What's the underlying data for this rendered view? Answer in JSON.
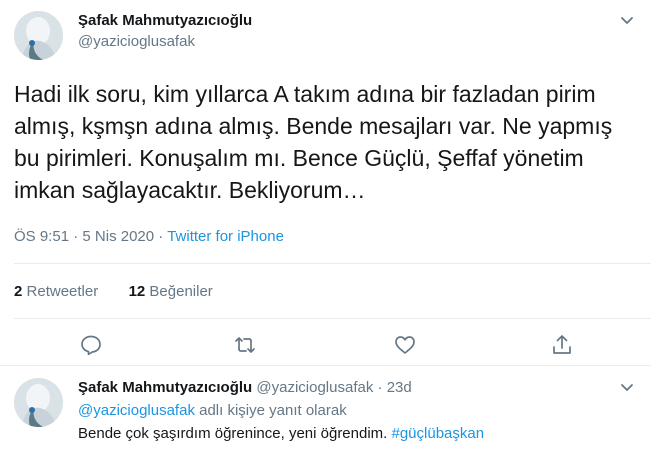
{
  "main_tweet": {
    "author": {
      "display_name": "Şafak Mahmutyazıcıoğlu",
      "handle": "@yazicioglusafak"
    },
    "text": "Hadi ilk soru, kim yıllarca A takım adına bir fazladan pirim almış, kşmşn adına almış. Bende mesajları var. Ne yapmış bu pirimleri. Konuşalım mı. Bence Güçlü, Şeffaf yönetim imkan sağlayacaktır. Bekliyorum…",
    "time": "ÖS 9:51",
    "separator": "·",
    "date": "5 Nis 2020",
    "source": "Twitter for iPhone",
    "stats": {
      "retweets_count": "2",
      "retweets_label": "Retweetler",
      "likes_count": "12",
      "likes_label": "Beğeniler"
    },
    "actions": [
      "reply-icon",
      "retweet-icon",
      "like-icon",
      "share-icon"
    ]
  },
  "reply_tweet": {
    "display_name": "Şafak Mahmutyazıcıoğlu",
    "handle": "@yazicioglusafak",
    "separator": "·",
    "time_ago": "23d",
    "reply_to_mention": "@yazicioglusafak",
    "reply_to_suffix": " adlı kişiye yanıt olarak",
    "text": "Bende çok şaşırdım öğrenince, yeni öğrendim. ",
    "hashtag": "#güçlübaşkan"
  },
  "colors": {
    "text_primary": "#14171a",
    "text_secondary": "#657786",
    "link": "#1b95e0",
    "divider": "#e6ecf0"
  }
}
